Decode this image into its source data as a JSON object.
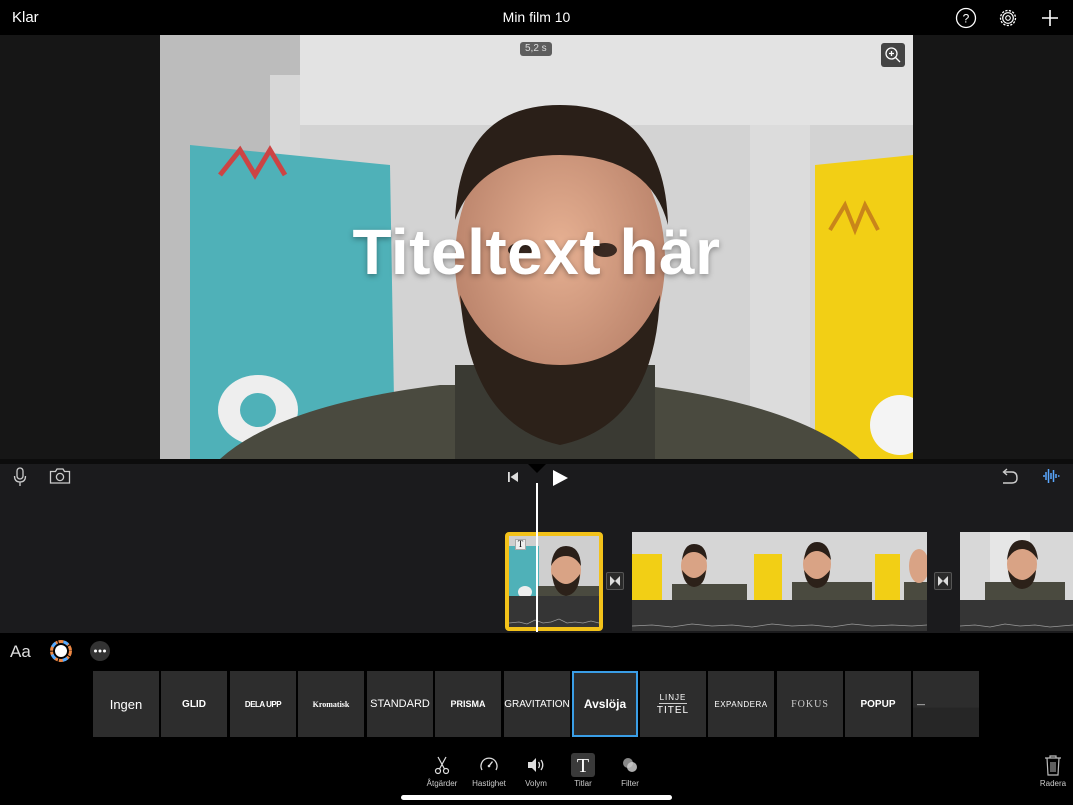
{
  "top_bar": {
    "done_label": "Klar",
    "title": "Min film 10"
  },
  "viewer": {
    "duration_badge": "5,2 s",
    "title_overlay_text": "Titeltext här"
  },
  "style_tools": {
    "font_label": "Aa"
  },
  "title_styles": [
    {
      "label": "Ingen"
    },
    {
      "label": "GLID"
    },
    {
      "label": "DELA UPP"
    },
    {
      "label": "Kromatisk"
    },
    {
      "label": "STANDARD"
    },
    {
      "label": "PRISMA"
    },
    {
      "label": "GRAVITATION"
    },
    {
      "label": "Avslöja",
      "selected": true
    },
    {
      "label_line1": "LINJE",
      "label_line2": "TITEL"
    },
    {
      "label": "EXPANDERA"
    },
    {
      "label": "FOKUS"
    },
    {
      "label": "POPUP"
    },
    {
      "label": "—"
    }
  ],
  "toolbar": {
    "actions": "Åtgärder",
    "speed": "Hastighet",
    "volume": "Volym",
    "titles": "Titlar",
    "filters": "Filter",
    "delete": "Radera"
  },
  "colors": {
    "accent": "#3a9ee6",
    "clip_selection": "#f3c21a",
    "waveform": "#5aa8ff"
  }
}
